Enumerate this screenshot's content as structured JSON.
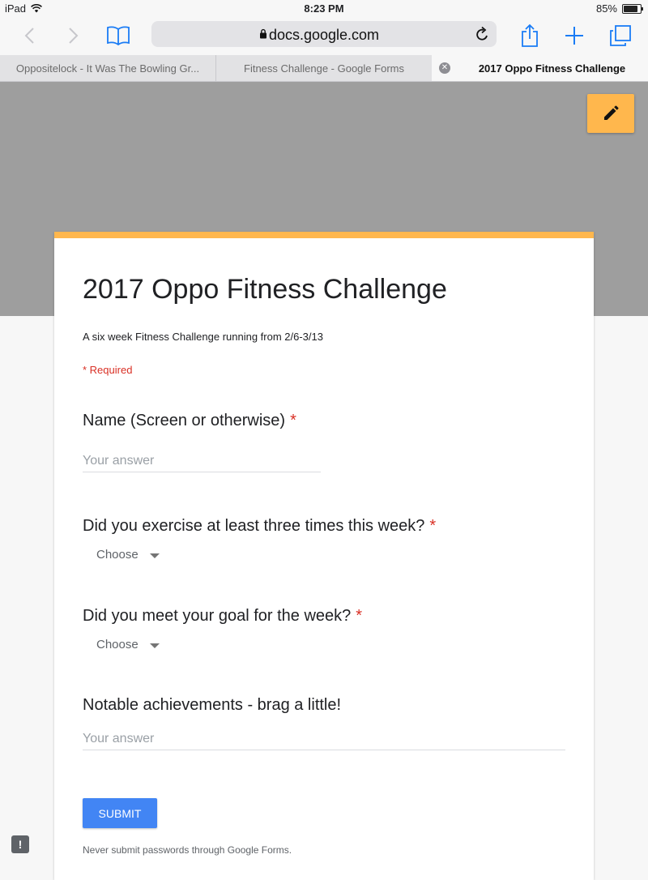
{
  "status_bar": {
    "device": "iPad",
    "time": "8:23 PM",
    "battery": "85%",
    "battery_level": 0.85
  },
  "toolbar": {
    "url": "docs.google.com"
  },
  "tabs": [
    {
      "label": "Oppositelock - It Was The Bowling Gr..."
    },
    {
      "label": "Fitness Challenge - Google Forms"
    },
    {
      "label": "2017 Oppo Fitness Challenge"
    }
  ],
  "form": {
    "title": "2017 Oppo Fitness Challenge",
    "description": "A six week Fitness Challenge running from 2/6-3/13",
    "required_note": "* Required",
    "questions": [
      {
        "title": "Name (Screen or otherwise)",
        "required": "*",
        "placeholder": "Your answer"
      },
      {
        "title": "Did you exercise at least three times this week?",
        "required": "*",
        "dropdown": "Choose"
      },
      {
        "title": "Did you meet your goal for the week?",
        "required": "*",
        "dropdown": "Choose"
      },
      {
        "title": "Notable achievements - brag a little!",
        "placeholder": "Your answer"
      }
    ],
    "submit_label": "SUBMIT",
    "footer": "Never submit passwords through Google Forms."
  },
  "feedback_label": "!",
  "colors": {
    "accent": "#ffb74d",
    "banner": "#9e9e9e",
    "submit": "#4285f4",
    "required": "#d93025",
    "ios_blue": "#1a7cf5"
  }
}
